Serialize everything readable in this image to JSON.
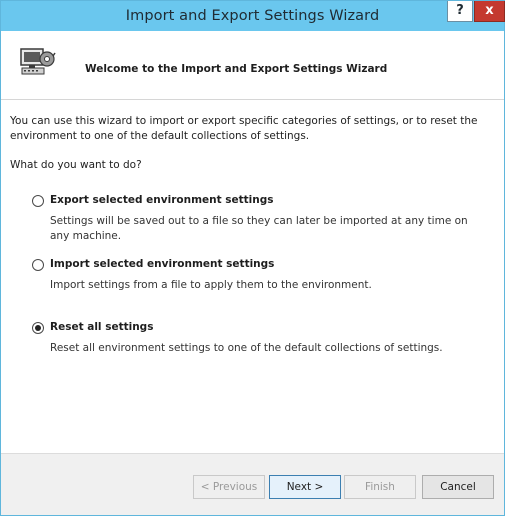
{
  "window": {
    "title": "Import and Export Settings Wizard",
    "help_glyph": "?",
    "close_glyph": "x",
    "titlebar_color": "#6ac7ee"
  },
  "header": {
    "title": "Welcome to the Import and Export Settings Wizard",
    "icon": "settings-wizard-computer-icon"
  },
  "main": {
    "intro": "You can use this wizard to import or export specific categories of settings, or to reset the environment to one of the default collections of settings.",
    "question": "What do you want to do?",
    "options": [
      {
        "label": "Export selected environment settings",
        "description": "Settings will be saved out to a file so they can later be imported at any time on any machine.",
        "selected": false
      },
      {
        "label": "Import selected environment settings",
        "description": "Import settings from a file to apply them to the environment.",
        "selected": false
      },
      {
        "label": "Reset all settings",
        "description": "Reset all environment settings to one of the default collections of settings.",
        "selected": true
      }
    ]
  },
  "footer": {
    "previous_label": "< Previous",
    "next_label": "Next >",
    "finish_label": "Finish",
    "cancel_label": "Cancel",
    "previous_enabled": false,
    "finish_enabled": false
  }
}
